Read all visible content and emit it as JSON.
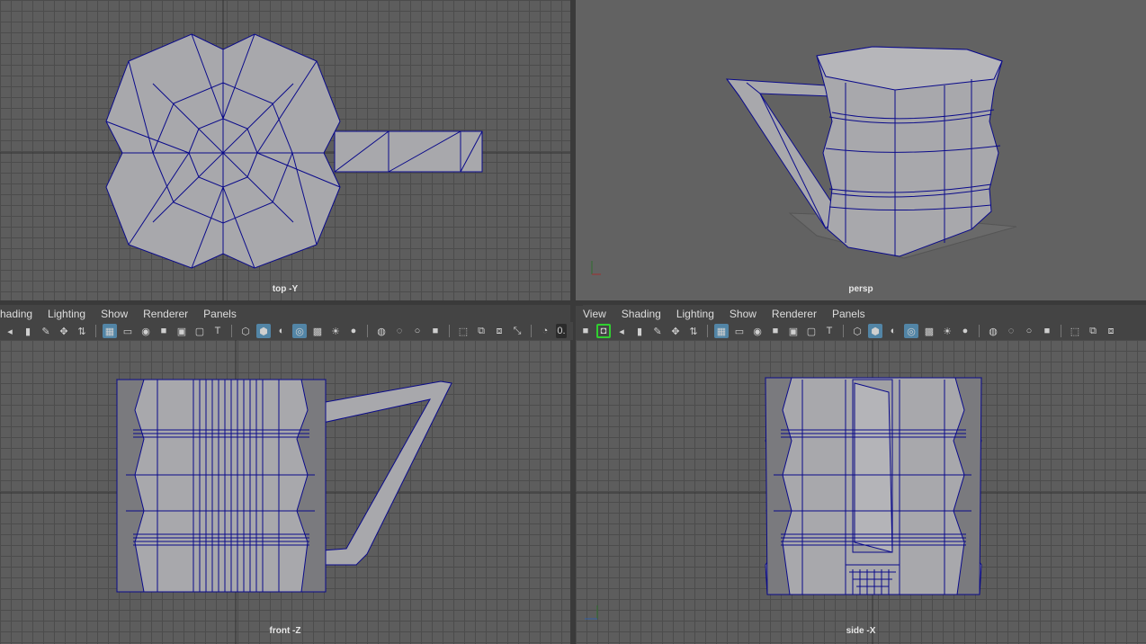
{
  "viewports": {
    "top_left": {
      "camera_label": "top -Y"
    },
    "top_right": {
      "camera_label": "persp"
    },
    "bottom_left": {
      "camera_label": "front -Z"
    },
    "bottom_right": {
      "camera_label": "side -X"
    }
  },
  "menus": {
    "left": [
      "hading",
      "Lighting",
      "Show",
      "Renderer",
      "Panels"
    ],
    "right": [
      "View",
      "Shading",
      "Lighting",
      "Show",
      "Renderer",
      "Panels"
    ]
  },
  "toolbar": {
    "left_value": "0."
  },
  "colors": {
    "wire": "#0a0a8a",
    "mesh": "#a8a8ac",
    "highlight": "#5285a6",
    "active_outline": "#30d030"
  }
}
